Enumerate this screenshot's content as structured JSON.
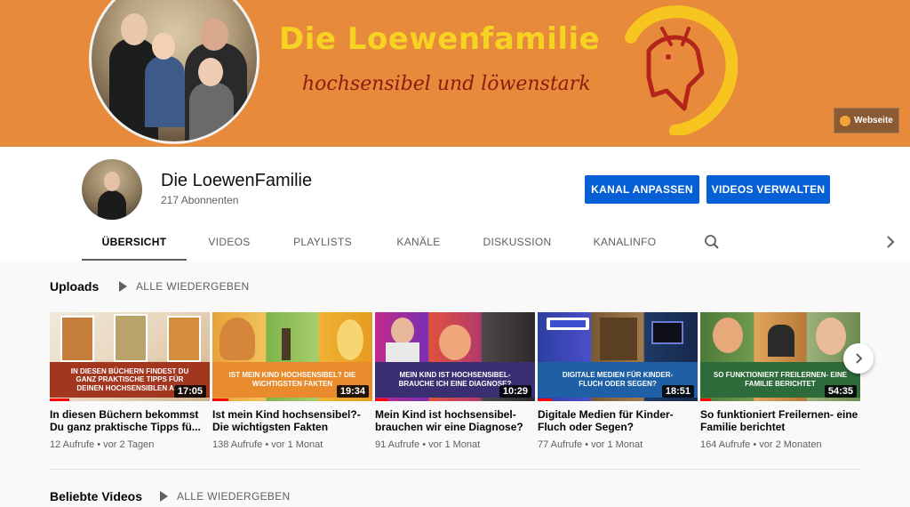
{
  "banner": {
    "title": "Die Loewenfamilie",
    "subtitle": "hochsensibel und löwenstark",
    "website_label": "Webseite"
  },
  "channel": {
    "name": "Die LoewenFamilie",
    "subscribers": "217 Abonnenten",
    "customize_button": "KANAL ANPASSEN",
    "manage_button": "VIDEOS VERWALTEN"
  },
  "tabs": [
    {
      "label": "ÜBERSICHT",
      "active": true
    },
    {
      "label": "VIDEOS"
    },
    {
      "label": "PLAYLISTS"
    },
    {
      "label": "KANÄLE"
    },
    {
      "label": "DISKUSSION"
    },
    {
      "label": "KANALINFO"
    }
  ],
  "icons": {
    "search": "search-icon",
    "tabs_next": "chevron-right-icon",
    "carousel_next": "chevron-right-icon",
    "play_all": "play-icon"
  },
  "uploads": {
    "title": "Uploads",
    "play_all": "ALLE WIEDERGEBEN",
    "videos": [
      {
        "thumb_text": "IN DIESEN BÜCHERN FINDEST DU GANZ PRAKTISCHE TIPPS FÜR DEINEN HOCHSENSIBLEN ALL",
        "duration": "17:05",
        "title": "In diesen Büchern bekommst Du ganz praktische Tipps fü...",
        "views": "12 Aufrufe",
        "age": "vor 2 Tagen",
        "band_color": "#a3361f"
      },
      {
        "thumb_text": "IST MEIN KIND HOCHSENSIBEL? DIE WICHTIGSTEN FAKTEN",
        "duration": "19:34",
        "title": "Ist mein Kind hochsensibel?- Die wichtigsten Fakten",
        "views": "138 Aufrufe",
        "age": "vor 1 Monat",
        "band_color": "#e98a2c"
      },
      {
        "thumb_text": "MEIN KIND IST HOCHSENSIBEL- BRAUCHE ICH EINE DIAGNOSE?",
        "duration": "10:29",
        "title": "Mein Kind ist hochsensibel- brauchen wir eine Diagnose?",
        "views": "91 Aufrufe",
        "age": "vor 1 Monat",
        "band_color": "#3a2f73"
      },
      {
        "thumb_text": "DIGITALE MEDIEN FÜR KINDER- FLUCH ODER SEGEN?",
        "duration": "18:51",
        "title": "Digitale Medien für Kinder- Fluch oder Segen?",
        "views": "77 Aufrufe",
        "age": "vor 1 Monat",
        "band_color": "#1f5fa6"
      },
      {
        "thumb_text": "SO FUNKTIONIERT FREILERNEN- EINE FAMILIE BERICHTET",
        "duration": "54:35",
        "title": "So funktioniert Freilernen- eine Familie berichtet",
        "views": "164 Aufrufe",
        "age": "vor 2 Monaten",
        "band_color": "#2e6b3a"
      }
    ]
  },
  "popular": {
    "title": "Beliebte Videos",
    "play_all": "ALLE WIEDERGEBEN"
  }
}
